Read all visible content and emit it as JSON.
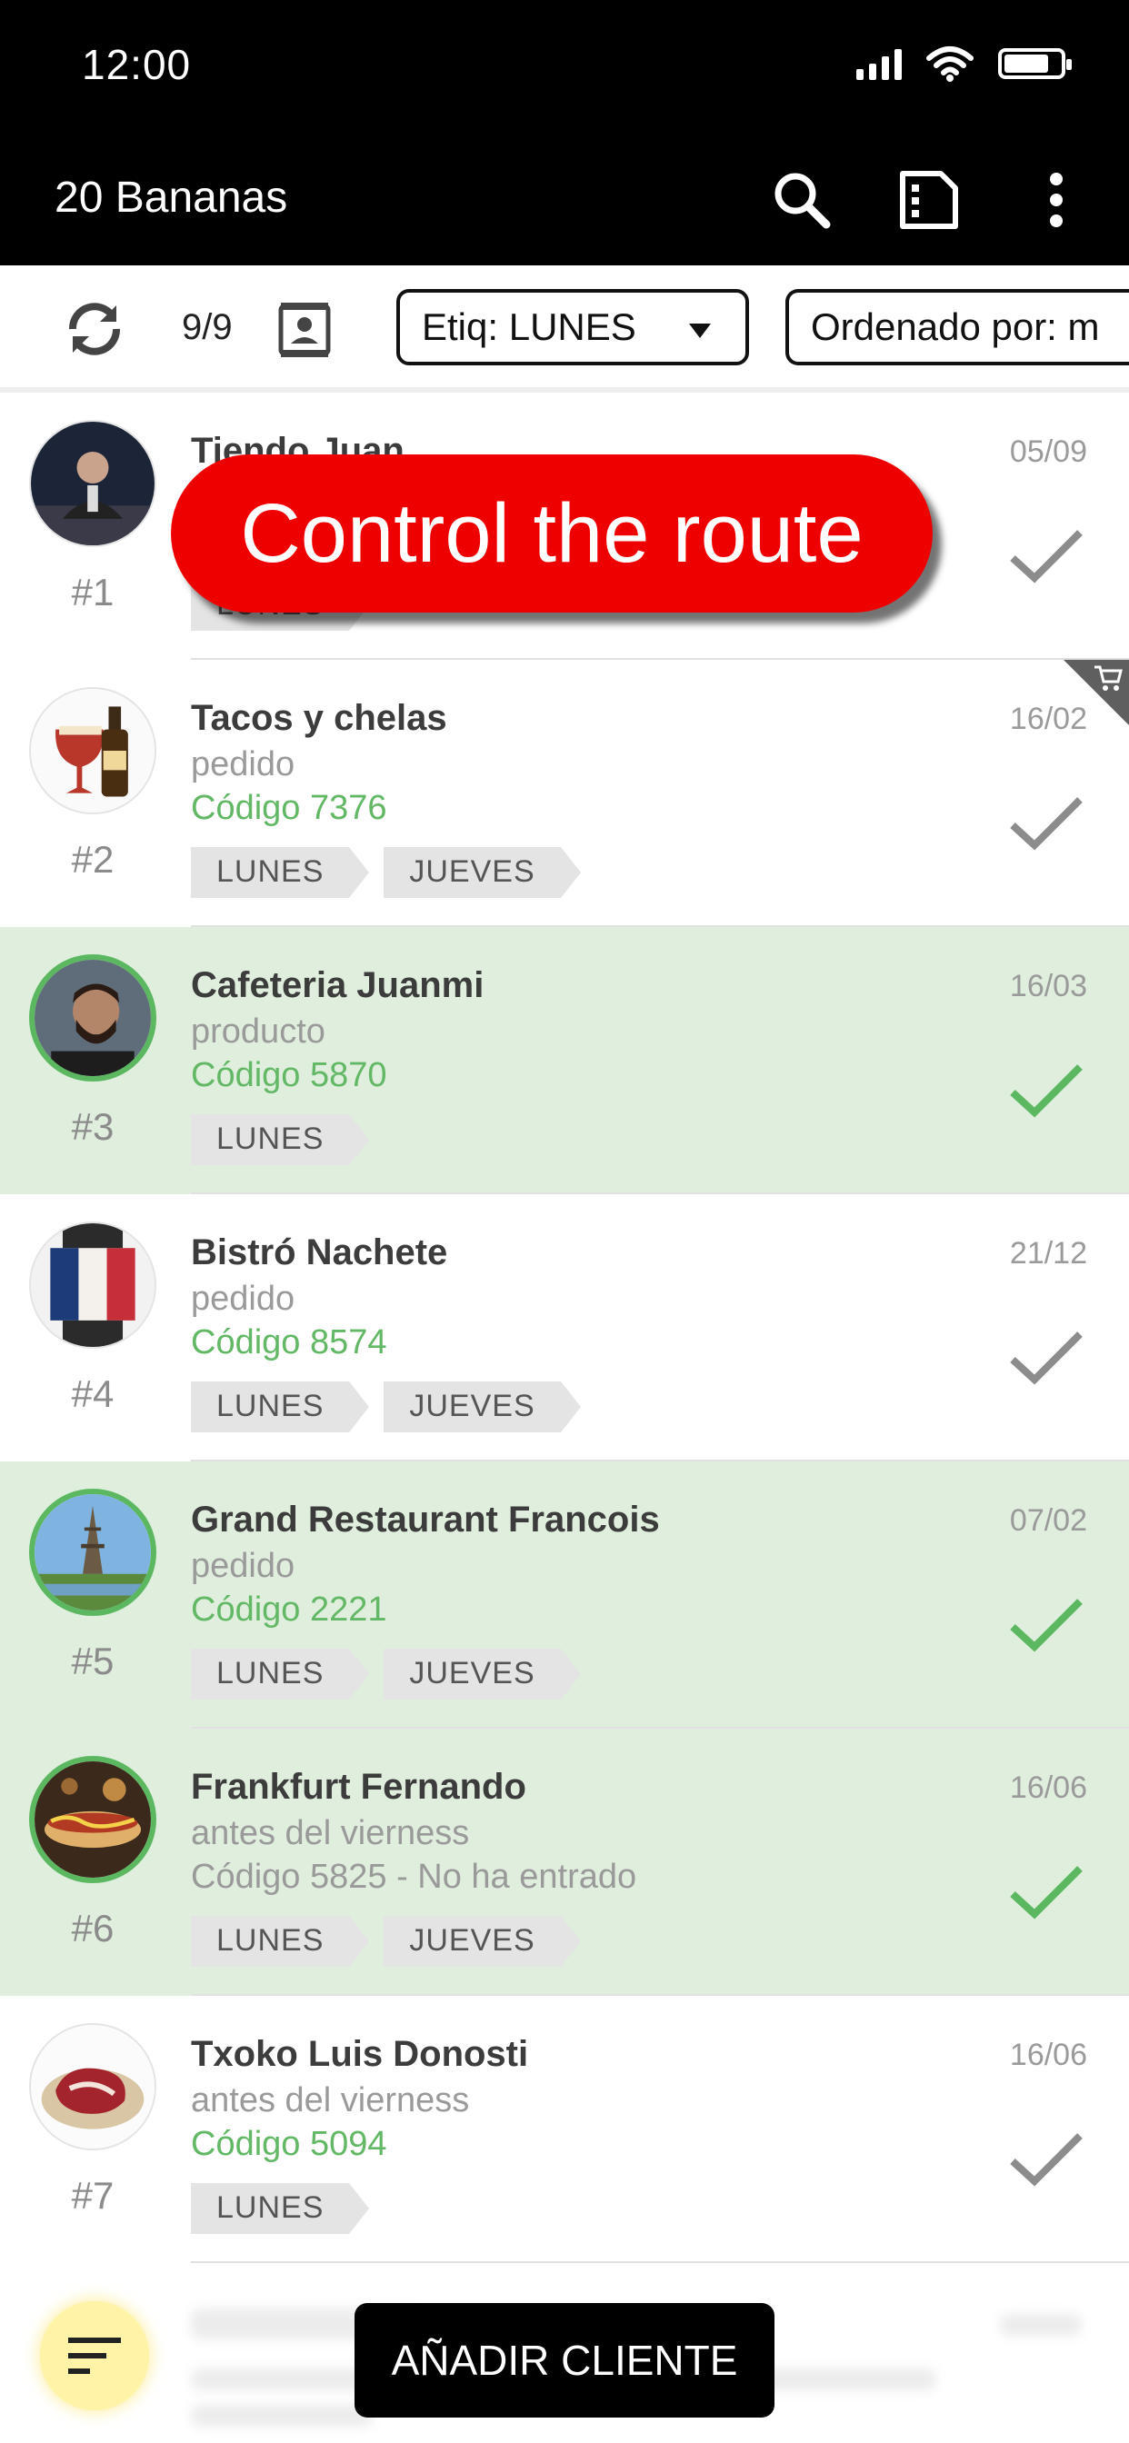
{
  "status_bar": {
    "time": "12:00"
  },
  "app_bar": {
    "title": "20 Bananas",
    "actions": [
      "search-icon",
      "filter-list-icon",
      "more-vert-icon"
    ]
  },
  "filters": {
    "count": "9/9",
    "tag_filter": "Etiq: LUNES",
    "order_filter": "Ordenado por: m"
  },
  "overlay": {
    "text": "Control the route"
  },
  "clients": [
    {
      "index": "#1",
      "name": "Tiendo Juan",
      "subtitle": "",
      "code": "",
      "date": "05/09",
      "tags": [
        "LUNES"
      ],
      "done": false
    },
    {
      "index": "#2",
      "name": "Tacos y chelas",
      "subtitle": "pedido",
      "code": "Código 7376",
      "date": "16/02",
      "tags": [
        "LUNES",
        "JUEVES"
      ],
      "done": false,
      "cart": true
    },
    {
      "index": "#3",
      "name": "Cafeteria Juanmi",
      "subtitle": "producto",
      "code": "Código 5870",
      "date": "16/03",
      "tags": [
        "LUNES"
      ],
      "done": true
    },
    {
      "index": "#4",
      "name": "Bistró Nachete",
      "subtitle": "pedido",
      "code": "Código 8574",
      "date": "21/12",
      "tags": [
        "LUNES",
        "JUEVES"
      ],
      "done": false
    },
    {
      "index": "#5",
      "name": "Grand Restaurant Francois",
      "subtitle": "pedido",
      "code": "Código 2221",
      "date": "07/02",
      "tags": [
        "LUNES",
        "JUEVES"
      ],
      "done": true
    },
    {
      "index": "#6",
      "name": "Frankfurt Fernando",
      "subtitle": "antes del vierness",
      "code": "Código 5825 - No ha entrado",
      "date": "16/06",
      "tags": [
        "LUNES",
        "JUEVES"
      ],
      "done": true
    },
    {
      "index": "#7",
      "name": "Txoko Luis Donosti",
      "subtitle": "antes del vierness",
      "code": "Código 5094",
      "date": "16/06",
      "tags": [
        "LUNES"
      ],
      "done": false
    }
  ],
  "bottom": {
    "add_button": "AÑADIR CLIENTE"
  },
  "colors": {
    "done_bg": "#dfeedd",
    "accent_green": "#63b866",
    "overlay_red": "#ef0000"
  }
}
